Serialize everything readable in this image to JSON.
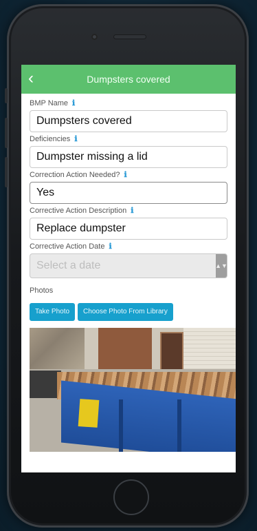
{
  "nav": {
    "back_icon": "‹",
    "title": "Dumpsters covered"
  },
  "form": {
    "bmp_name": {
      "label": "BMP Name",
      "value": "Dumpsters covered"
    },
    "deficiencies": {
      "label": "Deficiencies",
      "value": "Dumpster missing a lid"
    },
    "correction_needed": {
      "label": "Correction Action Needed?",
      "value": "Yes"
    },
    "corrective_description": {
      "label": "Corrective Action Description",
      "value": "Replace dumpster"
    },
    "corrective_date": {
      "label": "Corrective Action Date",
      "placeholder": "Select a date"
    },
    "info_icon": "ℹ"
  },
  "photos": {
    "label": "Photos",
    "take_photo": "Take Photo",
    "choose_library": "Choose Photo From Library"
  },
  "colors": {
    "navbar": "#5cc06e",
    "button": "#17a0cd",
    "info": "#2b9bd6"
  }
}
